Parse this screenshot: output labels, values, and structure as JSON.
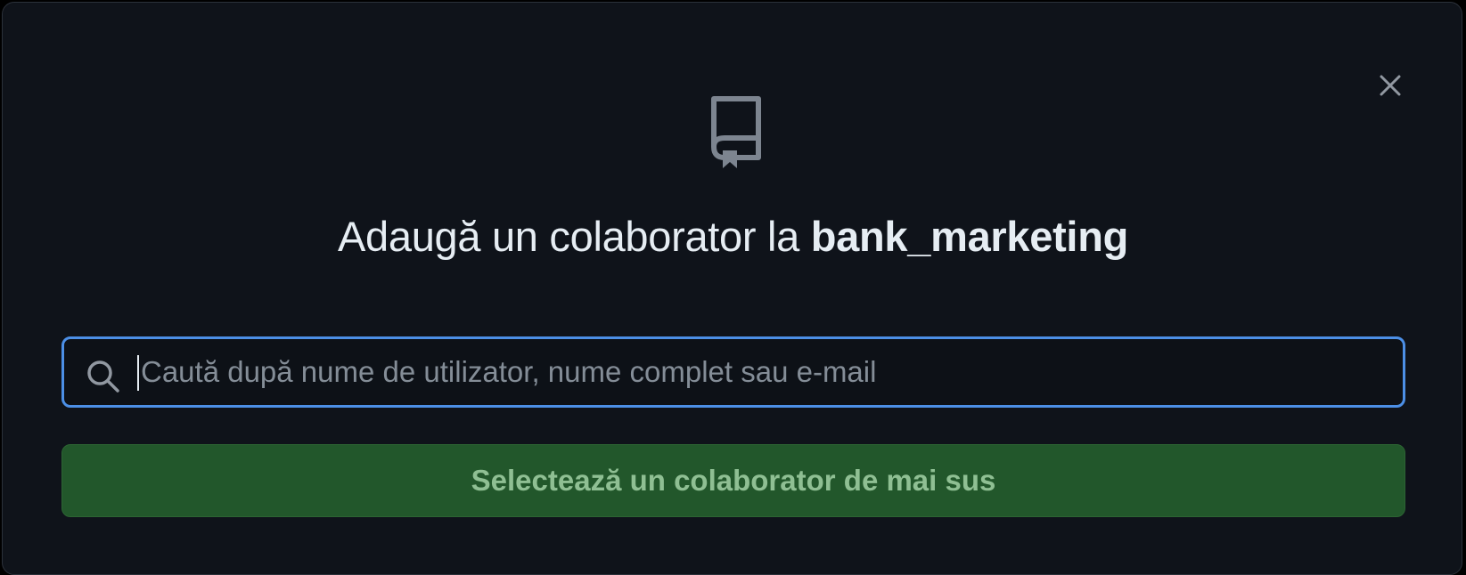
{
  "dialog": {
    "title_prefix": "Adaugă un colaborator la ",
    "repo_name": "bank_marketing",
    "icon": "repo-icon",
    "close_icon": "close-icon"
  },
  "search": {
    "icon": "search-icon",
    "placeholder": "Caută după nume de utilizator, nume complet sau e-mail",
    "value": ""
  },
  "submit": {
    "label": "Selectează un colaborator de mai sus",
    "disabled": true
  },
  "colors": {
    "background": "#0f131a",
    "text": "#e6edf3",
    "focus_border": "#4c8fe6",
    "button_bg": "#22572b",
    "button_text": "#8fbf93"
  }
}
